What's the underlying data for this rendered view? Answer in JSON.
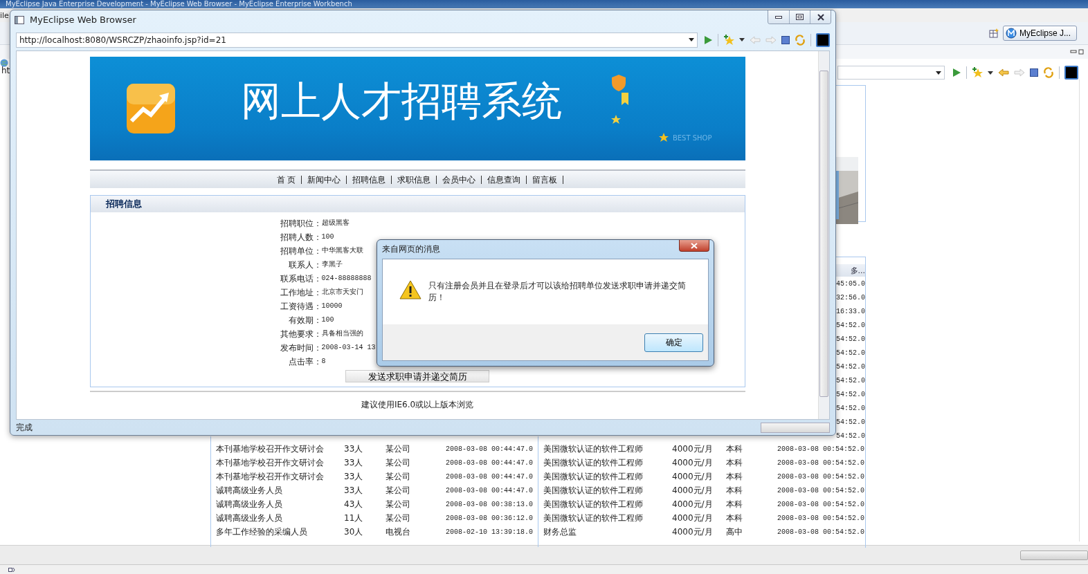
{
  "workbench": {
    "title": "MyEclipse Java Enterprise Development - MyEclipse Web Browser - MyEclipse Enterprise Workbench",
    "menu_fragment": "ile",
    "address_fragment": "ht",
    "perspective": "MyEclipse J..."
  },
  "background_page": {
    "more_link": "多...",
    "times": [
      "45:05.0",
      "32:56.0",
      "16:33.0",
      "54:52.0",
      "54:52.0",
      "54:52.0",
      "54:52.0",
      "54:52.0",
      "54:52.0",
      "54:52.0",
      "54:52.0",
      "54:52.0"
    ],
    "rows": [
      [
        "本刊基地学校召开作文研讨会",
        "33人",
        "某公司",
        "2008-03-08 00:44:47.0",
        "美国微软认证的软件工程师",
        "4000元/月",
        "本科",
        "2008-03-08 00:54:52.0"
      ],
      [
        "本刊基地学校召开作文研讨会",
        "33人",
        "某公司",
        "2008-03-08 00:44:47.0",
        "美国微软认证的软件工程师",
        "4000元/月",
        "本科",
        "2008-03-08 00:54:52.0"
      ],
      [
        "本刊基地学校召开作文研讨会",
        "33人",
        "某公司",
        "2008-03-08 00:44:47.0",
        "美国微软认证的软件工程师",
        "4000元/月",
        "本科",
        "2008-03-08 00:54:52.0"
      ],
      [
        "诚聘高级业务人员",
        "33人",
        "某公司",
        "2008-03-08 00:44:47.0",
        "美国微软认证的软件工程师",
        "4000元/月",
        "本科",
        "2008-03-08 00:54:52.0"
      ],
      [
        "诚聘高级业务人员",
        "43人",
        "某公司",
        "2008-03-08 00:38:13.0",
        "美国微软认证的软件工程师",
        "4000元/月",
        "本科",
        "2008-03-08 00:54:52.0"
      ],
      [
        "诚聘高级业务人员",
        "11人",
        "某公司",
        "2008-03-08 00:36:12.0",
        "美国微软认证的软件工程师",
        "4000元/月",
        "本科",
        "2008-03-08 00:54:52.0"
      ],
      [
        "多年工作经验的采编人员",
        "30人",
        "电视台",
        "2008-02-10 13:39:18.0",
        "财务总监",
        "4000元/月",
        "高中",
        "2008-03-08 00:54:52.0"
      ]
    ]
  },
  "browser": {
    "title": "MyEclipse Web Browser",
    "url": "http://localhost:8080/WSRCZP/zhaoinfo.jsp?id=21",
    "status": "完成",
    "progress": {
      "level": 0
    }
  },
  "page": {
    "banner_title": "网上人才招聘系统",
    "banner_badge": "BEST SHOP",
    "nav": [
      {
        "label": "首 页"
      },
      {
        "label": "新闻中心"
      },
      {
        "label": "招聘信息"
      },
      {
        "label": "求职信息"
      },
      {
        "label": "会员中心"
      },
      {
        "label": "信息查询"
      },
      {
        "label": "留言板"
      }
    ],
    "panel_title": "招聘信息",
    "fields": [
      {
        "label": "招聘职位：",
        "value": "超级黑客"
      },
      {
        "label": "招聘人数：",
        "value": "100"
      },
      {
        "label": "招聘单位：",
        "value": "中华黑客大联"
      },
      {
        "label": "联系人：",
        "value": "李黑子"
      },
      {
        "label": "联系电话：",
        "value": "024-88888888"
      },
      {
        "label": "工作地址：",
        "value": "北京市天安门"
      },
      {
        "label": "工资待遇：",
        "value": "10000"
      },
      {
        "label": "有效期：",
        "value": "100"
      },
      {
        "label": "其他要求：",
        "value": "具备相当强的"
      },
      {
        "label": "发布时间：",
        "value": "2008-03-14 13"
      },
      {
        "label": "点击率：",
        "value": "8"
      }
    ],
    "apply_button": "发送求职申请并递交简历",
    "footer": "建议使用IE6.0或以上版本浏览"
  },
  "dialog": {
    "title": "来自网页的消息",
    "message": "只有注册会员并且在登录后才可以该给招聘单位发送求职申请并递交简历！",
    "ok_button": "确定"
  }
}
